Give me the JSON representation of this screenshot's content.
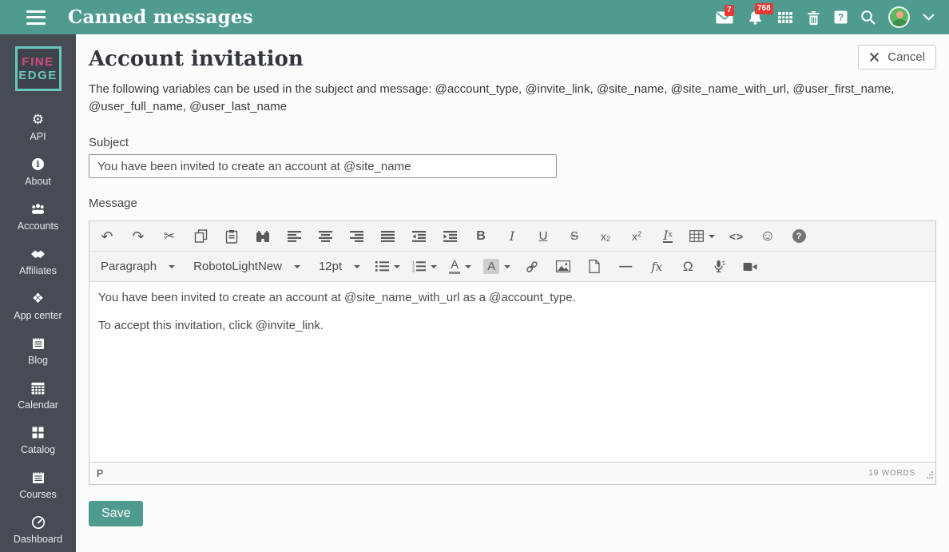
{
  "header": {
    "title": "Canned messages",
    "mail_badge": "7",
    "notifications_badge": "768"
  },
  "icons": {
    "gear": "⚙",
    "info": "i",
    "app_center": "❖",
    "help": "?",
    "n1": "1",
    "n2": "2",
    "n3": "3"
  },
  "sidebar": {
    "logo_line1": "FINE",
    "logo_line2": "EDGE",
    "items": [
      {
        "icon": "gear",
        "label": "API"
      },
      {
        "icon": "info-circle",
        "label": "About"
      },
      {
        "icon": "users",
        "label": "Accounts"
      },
      {
        "icon": "handshake",
        "label": "Affiliates"
      },
      {
        "icon": "app-diamonds",
        "label": "App center"
      },
      {
        "icon": "notepad",
        "label": "Blog"
      },
      {
        "icon": "calendar",
        "label": "Calendar"
      },
      {
        "icon": "squares",
        "label": "Catalog"
      },
      {
        "icon": "notebook",
        "label": "Courses"
      },
      {
        "icon": "gauge",
        "label": "Dashboard"
      }
    ]
  },
  "page": {
    "title": "Account invitation",
    "cancel_label": "Cancel",
    "description": "The following variables can be used in the subject and message: @account_type, @invite_link, @site_name, @site_name_with_url, @user_first_name, @user_full_name, @user_last_name"
  },
  "form": {
    "subject_label": "Subject",
    "subject_value": "You have been invited to create an account at @site_name",
    "message_label": "Message",
    "save_label": "Save"
  },
  "editor": {
    "selects": {
      "format": "Paragraph",
      "font": "RobotoLightNew",
      "size": "12pt"
    },
    "glyphs": {
      "undo": "↶",
      "redo": "↷",
      "cut": "✂",
      "bold": "B",
      "italic": "I",
      "underline": "U",
      "strikethrough": "S",
      "sub_base": "x",
      "sub_mark": "2",
      "sup_base": "x",
      "sup_mark": "2",
      "clear_base": "I",
      "clear_mark": "x",
      "code": "<>",
      "emoji": "☺",
      "help": "?",
      "forecolor": "A",
      "backcolor": "A",
      "hr": "—",
      "formula": "fx",
      "charmap": "Ω"
    },
    "content": {
      "p1": "You have been invited to create an account at @site_name_with_url as a @account_type.",
      "p2": "To accept this invitation, click @invite_link."
    },
    "statusbar": {
      "path": "P",
      "wordcount": "19 WORDS"
    }
  },
  "colors": {
    "accent_teal": "#4f9b90",
    "badge_red": "#e53935",
    "sidebar_bg": "#474c54",
    "logo_pink": "#d64a7e",
    "logo_teal": "#6ac6bd"
  }
}
